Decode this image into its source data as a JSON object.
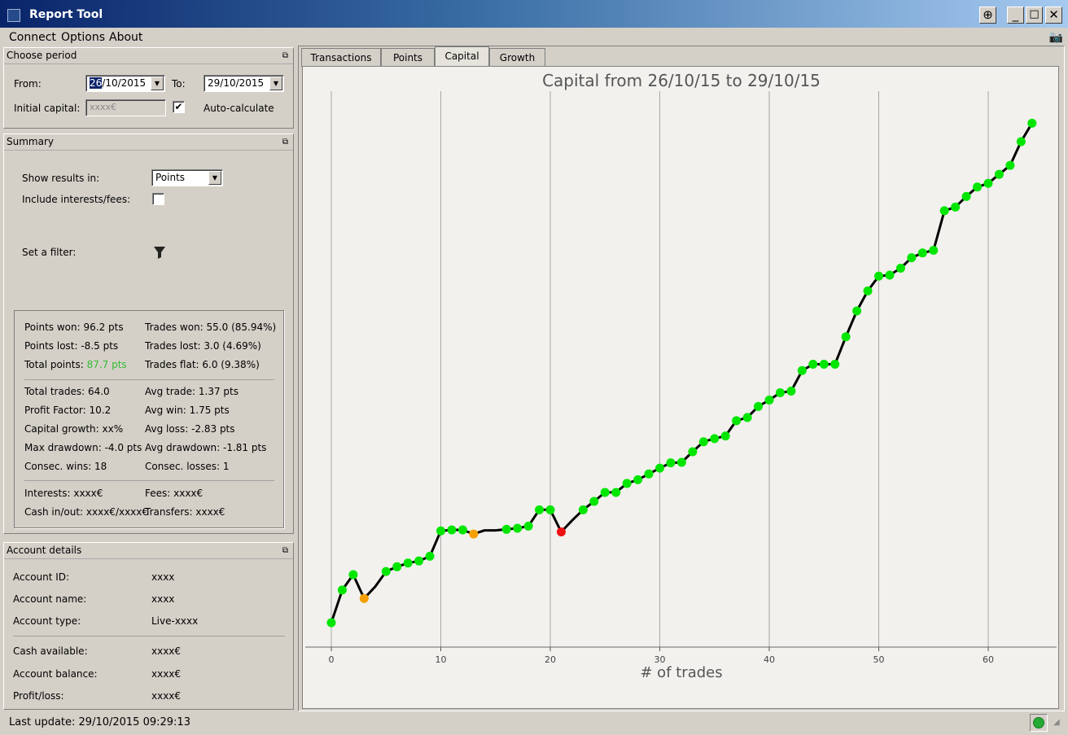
{
  "window": {
    "title": "Report Tool"
  },
  "menu": {
    "items": [
      "Connect",
      "Options",
      "About"
    ]
  },
  "period": {
    "header": "Choose period",
    "from_label": "From:",
    "from_day": "26",
    "from_rest": "/10/2015",
    "to_label": "To:",
    "to_value": "29/10/2015",
    "initial_capital_label": "Initial capital:",
    "initial_capital_value": "xxxx€",
    "auto_calculate_label": "Auto-calculate"
  },
  "summary": {
    "header": "Summary",
    "show_results_label": "Show results in:",
    "show_results_value": "Points",
    "include_fees_label": "Include interests/fees:",
    "filter_label": "Set a filter:",
    "stats": {
      "points_won": "Points won: 96.2 pts",
      "points_lost": "Points lost: -8.5 pts",
      "total_points_label": "Total points:",
      "total_points_value": "87.7 pts",
      "trades_won": "Trades won: 55.0 (85.94%)",
      "trades_lost": "Trades lost: 3.0 (4.69%)",
      "trades_flat": "Trades flat: 6.0 (9.38%)",
      "total_trades": "Total trades: 64.0",
      "profit_factor": "Profit Factor: 10.2",
      "capital_growth": "Capital growth: xx%",
      "max_drawdown": "Max drawdown: -4.0 pts",
      "consec_wins": "Consec. wins: 18",
      "avg_trade": "Avg trade: 1.37 pts",
      "avg_win": "Avg win: 1.75 pts",
      "avg_loss": "Avg loss: -2.83 pts",
      "avg_drawdown": "Avg drawdown: -1.81 pts",
      "consec_losses": "Consec. losses: 1",
      "interests": "Interests: xxxx€",
      "cash_inout": "Cash in/out: xxxx€/xxxx€",
      "fees": "Fees: xxxx€",
      "transfers": "Transfers: xxxx€"
    }
  },
  "account": {
    "header": "Account details",
    "rows": [
      {
        "label": "Account ID:",
        "value": "xxxx"
      },
      {
        "label": "Account name:",
        "value": "xxxx"
      },
      {
        "label": "Account type:",
        "value": "Live-xxxx"
      },
      {
        "label": "Cash available:",
        "value": "xxxx€"
      },
      {
        "label": "Account balance:",
        "value": "xxxx€"
      },
      {
        "label": "Profit/loss:",
        "value": "xxxx€"
      }
    ]
  },
  "status": {
    "last_update": "Last update: 29/10/2015 09:29:13"
  },
  "tabs": [
    "Transactions",
    "Points",
    "Capital",
    "Growth"
  ],
  "colors": {
    "win": "#00e600",
    "flat": "#f5a000",
    "loss": "#ee1111",
    "line": "#000000",
    "total_points": "#33bb33"
  },
  "chart_data": {
    "type": "line",
    "title": "Capital from 26/10/15 to 29/10/15",
    "xlabel": "# of trades",
    "ylabel": "",
    "xlim": [
      -1,
      66
    ],
    "ylim": [
      0,
      100
    ],
    "xticks": [
      0,
      10,
      20,
      30,
      40,
      50,
      60
    ],
    "grid": "vertical",
    "points": [
      {
        "x": 0,
        "y": 0,
        "c": "win"
      },
      {
        "x": 1,
        "y": 6.2,
        "c": "win"
      },
      {
        "x": 2,
        "y": 9.1,
        "c": "win"
      },
      {
        "x": 3,
        "y": 4.6,
        "c": "flat"
      },
      {
        "x": 4,
        "y": 6.8,
        "c": null
      },
      {
        "x": 5,
        "y": 9.7,
        "c": "win"
      },
      {
        "x": 6,
        "y": 10.6,
        "c": "win"
      },
      {
        "x": 7,
        "y": 11.3,
        "c": "win"
      },
      {
        "x": 8,
        "y": 11.7,
        "c": "win"
      },
      {
        "x": 9,
        "y": 12.6,
        "c": "win"
      },
      {
        "x": 10,
        "y": 17.4,
        "c": "win"
      },
      {
        "x": 11,
        "y": 17.6,
        "c": "win"
      },
      {
        "x": 12,
        "y": 17.6,
        "c": "win"
      },
      {
        "x": 13,
        "y": 16.8,
        "c": "flat"
      },
      {
        "x": 14,
        "y": 17.5,
        "c": null
      },
      {
        "x": 15,
        "y": 17.5,
        "c": null
      },
      {
        "x": 16,
        "y": 17.7,
        "c": "win"
      },
      {
        "x": 17,
        "y": 17.9,
        "c": "win"
      },
      {
        "x": 18,
        "y": 18.3,
        "c": "win"
      },
      {
        "x": 19,
        "y": 21.4,
        "c": "win"
      },
      {
        "x": 20,
        "y": 21.4,
        "c": "win"
      },
      {
        "x": 21,
        "y": 17.2,
        "c": "loss"
      },
      {
        "x": 22,
        "y": 19.4,
        "c": null
      },
      {
        "x": 23,
        "y": 21.4,
        "c": "win"
      },
      {
        "x": 24,
        "y": 23.0,
        "c": "win"
      },
      {
        "x": 25,
        "y": 24.7,
        "c": "win"
      },
      {
        "x": 26,
        "y": 24.7,
        "c": "win"
      },
      {
        "x": 27,
        "y": 26.4,
        "c": "win"
      },
      {
        "x": 28,
        "y": 27.1,
        "c": "win"
      },
      {
        "x": 29,
        "y": 28.2,
        "c": "win"
      },
      {
        "x": 30,
        "y": 29.3,
        "c": "win"
      },
      {
        "x": 31,
        "y": 30.3,
        "c": "win"
      },
      {
        "x": 32,
        "y": 30.4,
        "c": "win"
      },
      {
        "x": 33,
        "y": 32.4,
        "c": "win"
      },
      {
        "x": 34,
        "y": 34.3,
        "c": "win"
      },
      {
        "x": 35,
        "y": 34.9,
        "c": "win"
      },
      {
        "x": 36,
        "y": 35.4,
        "c": "win"
      },
      {
        "x": 37,
        "y": 38.3,
        "c": "win"
      },
      {
        "x": 38,
        "y": 38.9,
        "c": "win"
      },
      {
        "x": 39,
        "y": 41.0,
        "c": "win"
      },
      {
        "x": 40,
        "y": 42.2,
        "c": "win"
      },
      {
        "x": 41,
        "y": 43.6,
        "c": "win"
      },
      {
        "x": 42,
        "y": 43.9,
        "c": "win"
      },
      {
        "x": 43,
        "y": 47.8,
        "c": "win"
      },
      {
        "x": 44,
        "y": 49.0,
        "c": "win"
      },
      {
        "x": 45,
        "y": 49.0,
        "c": "win"
      },
      {
        "x": 46,
        "y": 49.0,
        "c": "win"
      },
      {
        "x": 47,
        "y": 54.2,
        "c": "win"
      },
      {
        "x": 48,
        "y": 59.1,
        "c": "win"
      },
      {
        "x": 49,
        "y": 62.9,
        "c": "win"
      },
      {
        "x": 50,
        "y": 65.7,
        "c": "win"
      },
      {
        "x": 51,
        "y": 65.9,
        "c": "win"
      },
      {
        "x": 52,
        "y": 67.2,
        "c": "win"
      },
      {
        "x": 53,
        "y": 69.2,
        "c": "win"
      },
      {
        "x": 54,
        "y": 70.1,
        "c": "win"
      },
      {
        "x": 55,
        "y": 70.6,
        "c": "win"
      },
      {
        "x": 56,
        "y": 78.1,
        "c": "win"
      },
      {
        "x": 57,
        "y": 78.8,
        "c": "win"
      },
      {
        "x": 58,
        "y": 80.8,
        "c": "win"
      },
      {
        "x": 59,
        "y": 82.6,
        "c": "win"
      },
      {
        "x": 60,
        "y": 83.3,
        "c": "win"
      },
      {
        "x": 61,
        "y": 85.0,
        "c": "win"
      },
      {
        "x": 62,
        "y": 86.7,
        "c": "win"
      },
      {
        "x": 63,
        "y": 91.2,
        "c": "win"
      },
      {
        "x": 64,
        "y": 94.7,
        "c": "win"
      }
    ]
  }
}
